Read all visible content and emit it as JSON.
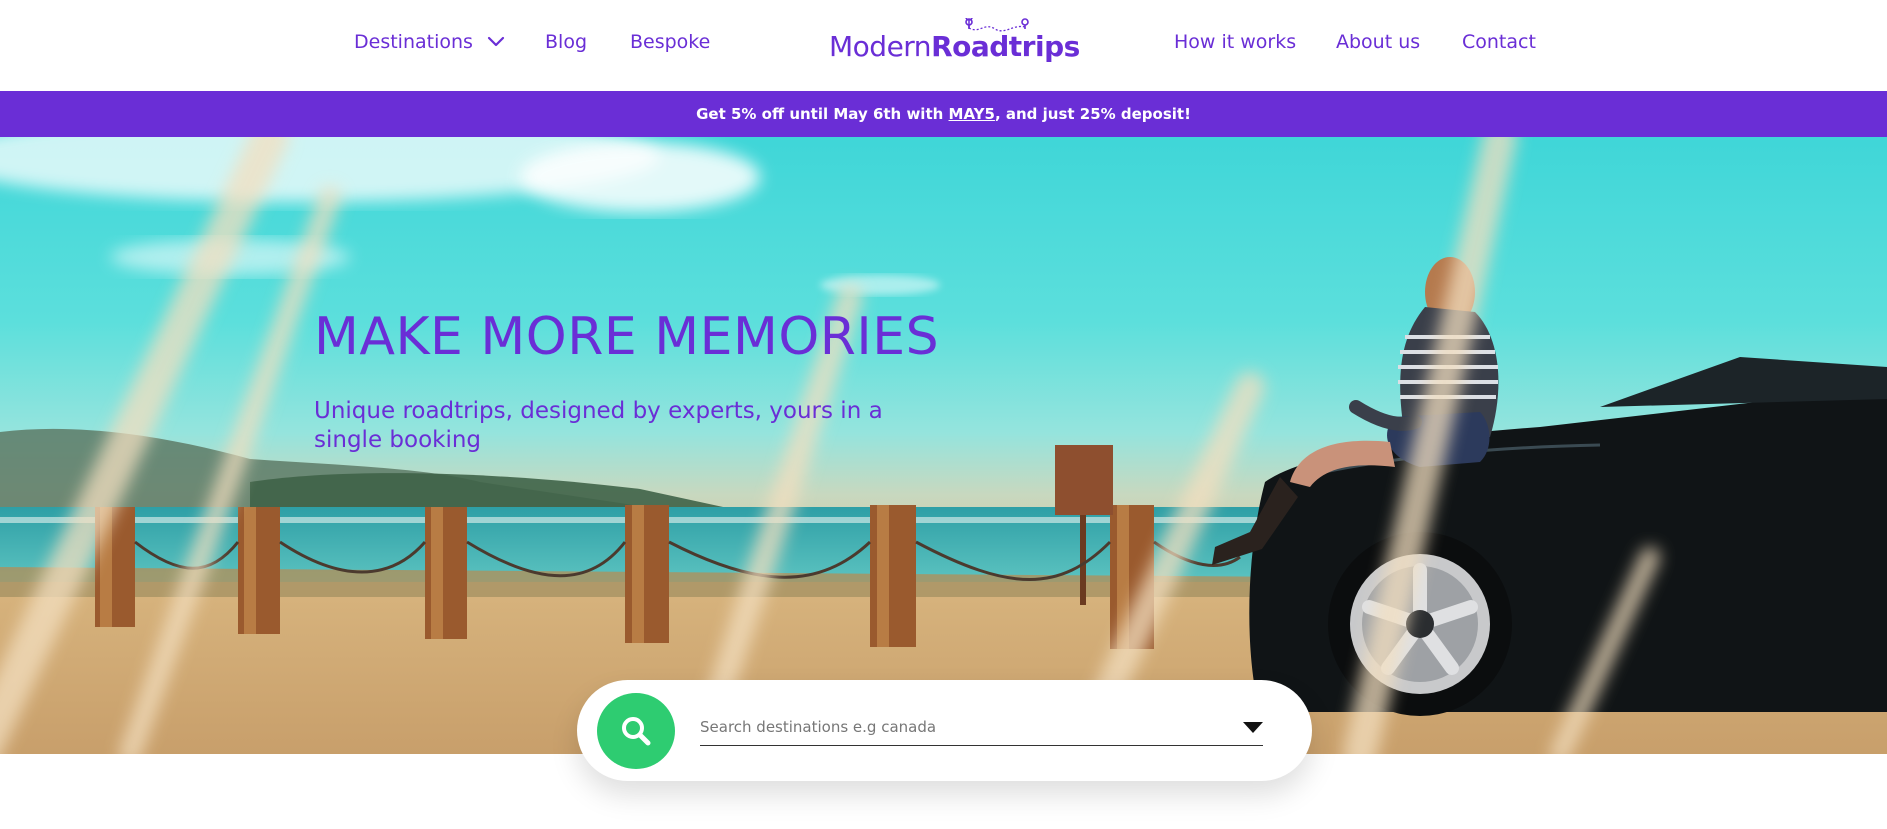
{
  "header": {
    "nav_left": [
      {
        "label": "Destinations",
        "has_dropdown": true
      },
      {
        "label": "Blog"
      },
      {
        "label": "Bespoke"
      }
    ],
    "logo": {
      "light": "Modern",
      "bold": "Roadtrips"
    },
    "nav_right": [
      {
        "label": "How it works"
      },
      {
        "label": "About us"
      },
      {
        "label": "Contact"
      }
    ]
  },
  "promo": {
    "before": "Get 5% off until May 6th with ",
    "code": "MAY5",
    "after": ", and just 25% deposit!"
  },
  "hero": {
    "title": "MAKE MORE MEMORIES",
    "subtitle": "Unique roadtrips, designed by experts, yours in a single booking"
  },
  "search": {
    "placeholder": "Search destinations e.g canada",
    "button_icon": "search-icon",
    "dropdown_icon": "caret-down-icon"
  },
  "colors": {
    "brand_purple": "#6a2ed6",
    "search_green": "#2ecc71"
  }
}
